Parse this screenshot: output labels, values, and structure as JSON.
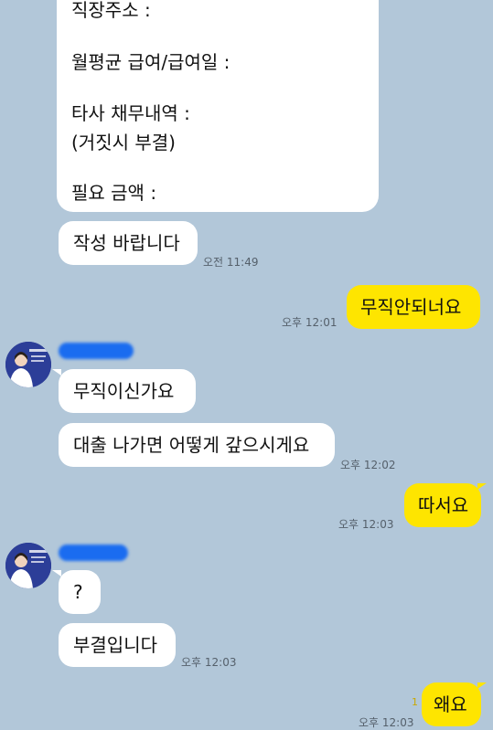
{
  "form_message": {
    "lines": [
      "직장주소 :",
      "월평균 급여/급여일 :",
      "타사 채무내역 :",
      "(거짓시 부결)",
      "필요 금액 :"
    ]
  },
  "messages": [
    {
      "side": "left",
      "text": "작성 바랍니다",
      "time": "오전 11:49"
    },
    {
      "side": "right",
      "text": "무직안되너요",
      "time": "오후 12:01"
    },
    {
      "side": "left",
      "text": "무직이신가요",
      "time": ""
    },
    {
      "side": "left",
      "text": "대출 나가면 어떻게 갚으시게요",
      "time": "오후 12:02"
    },
    {
      "side": "right",
      "text": "따서요",
      "time": "오후 12:03"
    },
    {
      "side": "left",
      "text": "?",
      "time": ""
    },
    {
      "side": "left",
      "text": "부결입니다",
      "time": "오후 12:03"
    },
    {
      "side": "right",
      "text": "왜요",
      "time": "오후 12:03",
      "read_count": "1"
    }
  ],
  "colors": {
    "background": "#b2c7d9",
    "my_bubble": "#fee500",
    "their_bubble": "#ffffff",
    "name_redaction": "#1a6cf0"
  },
  "avatar_icon": "profile-avatar-icon"
}
